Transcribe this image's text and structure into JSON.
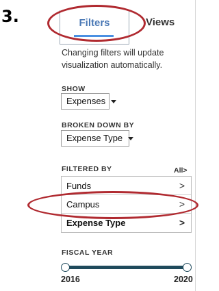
{
  "step_number": "3.",
  "tabs": {
    "filters_label": "Filters",
    "views_label": "Views"
  },
  "help_text": "Changing filters will update visualization automatically.",
  "show": {
    "label": "SHOW",
    "selected": "Expenses"
  },
  "broken_down_by": {
    "label": "BROKEN DOWN BY",
    "selected": "Expense Type"
  },
  "filtered_by": {
    "label": "FILTERED BY",
    "all_link": "All",
    "items": [
      {
        "label": "Funds"
      },
      {
        "label": "Campus"
      },
      {
        "label": "Expense Type"
      }
    ]
  },
  "fiscal_year": {
    "label": "FISCAL YEAR",
    "start_year": "2016",
    "end_year": "2020",
    "range_start_fraction": 0,
    "range_end_fraction": 1
  },
  "colors": {
    "accent_blue": "#4a78b5",
    "annotation_red": "#b02a30",
    "slider_dark": "#1f4a5c"
  }
}
